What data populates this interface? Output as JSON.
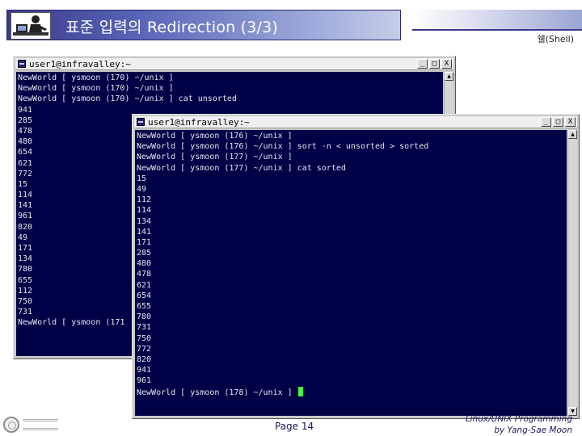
{
  "slide": {
    "title": "표준 입력의 Redirection (3/3)",
    "section_label": "쉘(Shell)",
    "page": "Page 14",
    "credit_line1": "Linux/UNIX Programming",
    "credit_line2": "by Yang-Sae Moon"
  },
  "win1": {
    "title": "user1@infravalley:~",
    "lines": [
      "NewWorld [ ysmoon (170) ~/unix ]",
      "NewWorld [ ysmoon (170) ~/unix ]",
      "NewWorld [ ysmoon (170) ~/unix ] cat unsorted",
      "941",
      "285",
      "478",
      "480",
      "654",
      "621",
      "772",
      "15",
      "114",
      "141",
      "961",
      "820",
      "49",
      "171",
      "134",
      "780",
      "655",
      "112",
      "750",
      "731",
      "NewWorld [ ysmoon (171"
    ]
  },
  "win2": {
    "title": "user1@infravalley:~",
    "lines": [
      "NewWorld [ ysmoon (176) ~/unix ]",
      "NewWorld [ ysmoon (176) ~/unix ] sort -n < unsorted > sorted",
      "NewWorld [ ysmoon (177) ~/unix ]",
      "NewWorld [ ysmoon (177) ~/unix ] cat sorted",
      "15",
      "49",
      "112",
      "114",
      "134",
      "141",
      "171",
      "285",
      "480",
      "478",
      "621",
      "654",
      "655",
      "780",
      "731",
      "750",
      "772",
      "820",
      "941",
      "961"
    ],
    "prompt": "NewWorld [ ysmoon (178) ~/unix ] "
  },
  "window_buttons": {
    "minimize": "_",
    "maximize": "□",
    "close": "X"
  },
  "icons": {
    "terminal": "terminal-icon",
    "scroll_up": "scroll-up-icon",
    "scroll_down": "scroll-down-icon",
    "university_seal": "university-seal-icon",
    "author_figure": "author-figure-icon"
  },
  "colors": {
    "terminal_bg": "#000046",
    "terminal_text": "#e4e4ee",
    "cursor": "#3cff3c",
    "title_bar": "#3a3a8c"
  }
}
